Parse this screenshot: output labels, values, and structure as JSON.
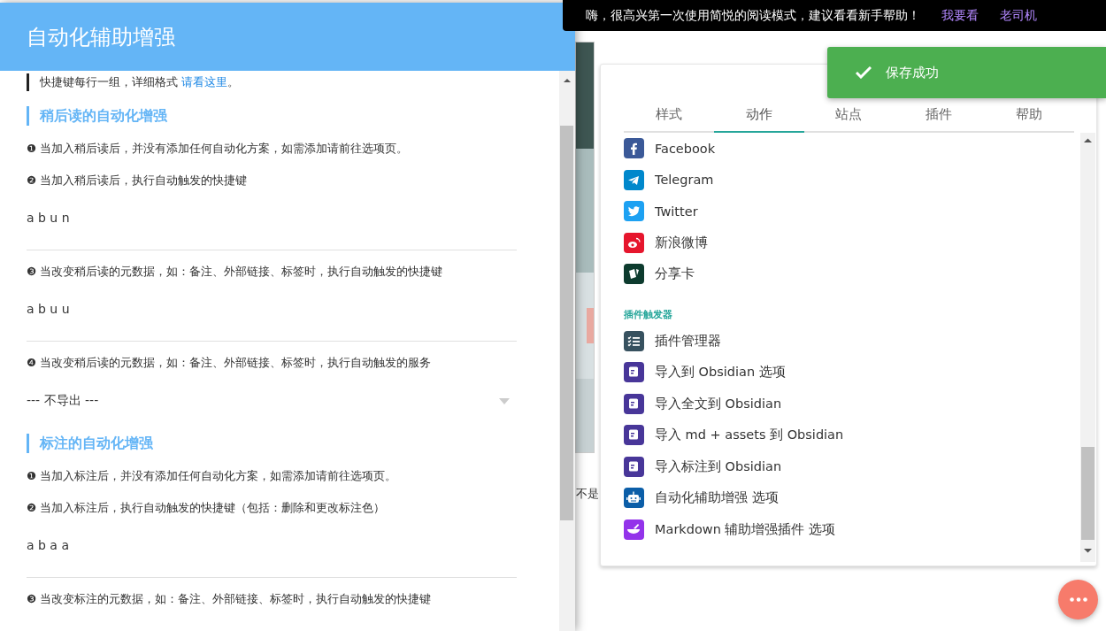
{
  "background": {
    "text": "不是"
  },
  "notice": {
    "text": "嗨，很高兴第一次使用简悦的阅读模式，建议看看新手帮助！",
    "actions": [
      "我要看",
      "老司机"
    ]
  },
  "dialog": {
    "title": "自动化辅助增强",
    "blocks": [
      {
        "kind": "quote",
        "text": "快捷键每行一组，详细格式 ",
        "link": "请看这里",
        "after": "。"
      },
      {
        "kind": "heading",
        "text": "稍后读的自动化增强"
      },
      {
        "kind": "text",
        "text": "❶ 当加入稍后读后，并没有添加任何自动化方案，如需添加请前往选项页。"
      },
      {
        "kind": "text",
        "text": "❷ 当加入稍后读后，执行自动触发的快捷键"
      },
      {
        "kind": "value",
        "text": "a b u n"
      },
      {
        "kind": "text",
        "text": "❸ 当改变稍后读的元数据，如：备注、外部链接、标签时，执行自动触发的快捷键"
      },
      {
        "kind": "value",
        "text": "a b u u"
      },
      {
        "kind": "text",
        "text": "❹ 当改变稍后读的元数据，如：备注、外部链接、标签时，执行自动触发的服务"
      },
      {
        "kind": "select",
        "text": "--- 不导出 ---"
      },
      {
        "kind": "heading",
        "text": "标注的自动化增强"
      },
      {
        "kind": "text",
        "text": "❶ 当加入标注后，并没有添加任何自动化方案，如需添加请前往选项页。"
      },
      {
        "kind": "text",
        "text": "❷ 当加入标注后，执行自动触发的快捷键（包括：删除和更改标注色）"
      },
      {
        "kind": "value",
        "text": "a b a a"
      },
      {
        "kind": "text",
        "text": "❸ 当改变标注的元数据，如：备注、外部链接、标签时，执行自动触发的快捷键"
      }
    ]
  },
  "panel": {
    "tabs": [
      {
        "label": "样式",
        "selected": false
      },
      {
        "label": "动作",
        "selected": true
      },
      {
        "label": "站点",
        "selected": false
      },
      {
        "label": "插件",
        "selected": false
      },
      {
        "label": "帮助",
        "selected": false
      }
    ],
    "items": [
      {
        "kind": "item",
        "label": "Facebook",
        "color": "#3b5998"
      },
      {
        "kind": "item",
        "label": "Telegram",
        "color": "#0088cc"
      },
      {
        "kind": "item",
        "label": "Twitter",
        "color": "#1da1f2"
      },
      {
        "kind": "item",
        "label": "新浪微博",
        "color": "#e6162d"
      },
      {
        "kind": "item",
        "label": "分享卡",
        "color": "#0d3b2e"
      },
      {
        "kind": "section",
        "label": "插件触发器"
      },
      {
        "kind": "item",
        "label": "插件管理器",
        "color": "#37515f"
      },
      {
        "kind": "item",
        "label": "导入到 Obsidian 选项",
        "color": "#483699"
      },
      {
        "kind": "item",
        "label": "导入全文到 Obsidian",
        "color": "#483699"
      },
      {
        "kind": "item",
        "label": "导入 md + assets 到 Obsidian",
        "color": "#483699"
      },
      {
        "kind": "item",
        "label": "导入标注到 Obsidian",
        "color": "#483699"
      },
      {
        "kind": "item",
        "label": "自动化辅助增强 选项",
        "color": "#0b5ea8"
      },
      {
        "kind": "item",
        "label": "Markdown 辅助增强插件 选项",
        "color": "#9333ea"
      }
    ]
  },
  "toast": {
    "text": "保存成功"
  }
}
